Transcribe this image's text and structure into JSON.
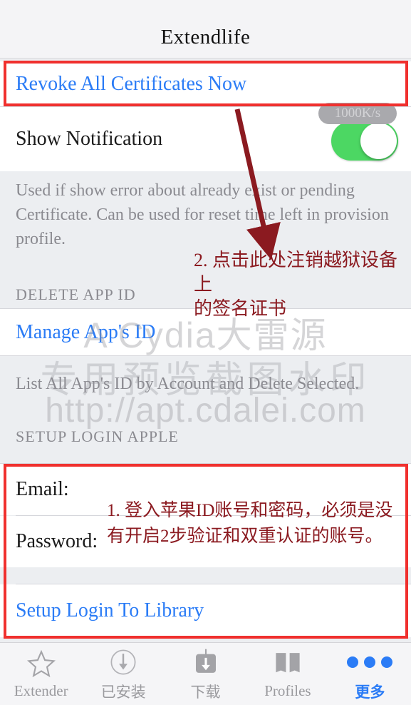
{
  "navbar": {
    "title": "Extendlife"
  },
  "rows": {
    "revoke_label": "Revoke All Certificates Now",
    "notification_label": "Show Notification",
    "manage_app_id_label": "Manage App's ID",
    "setup_login_label": "Setup Login To Library"
  },
  "status": {
    "speed_badge": "1000K/s",
    "notification_toggle_state": "on"
  },
  "groups": {
    "revoke_description": "Used if show error about already exist or pending Certificate. Can be used for reset time left in provision profile.",
    "delete_app_id_header": "DELETE APP ID",
    "manage_description": "List All App's ID by Account and Delete Selected.",
    "setup_login_header": "SETUP LOGIN APPLE"
  },
  "form": {
    "email_label": "Email:",
    "email_value": "",
    "email_placeholder": "",
    "password_label": "Password:",
    "password_value": "",
    "password_placeholder": ""
  },
  "watermark": {
    "line1": "A Cydia大雷源",
    "line2": "专用预览截图水印",
    "line3": "http://apt.cdalei.com"
  },
  "annotations": {
    "note_2": "2. 点击此处注销越狱设备上\n的签名证书",
    "note_1": "1.  登入苹果ID账号和密码，必须是没\n有开启2步验证和双重认证的账号。"
  },
  "tabbar": {
    "items": [
      {
        "label": "Extender",
        "icon": "star-icon",
        "active": false
      },
      {
        "label": "已安装",
        "icon": "circle-download-icon",
        "active": false
      },
      {
        "label": "下载",
        "icon": "download-box-icon",
        "active": false
      },
      {
        "label": "Profiles",
        "icon": "book-icon",
        "active": false
      },
      {
        "label": "更多",
        "icon": "ellipsis-icon",
        "active": true
      }
    ]
  },
  "colors": {
    "link_blue": "#2b7cf6",
    "toggle_green": "#4cd763",
    "annotation_red": "#8b1a20",
    "highlight_box_red": "#f0302e"
  }
}
